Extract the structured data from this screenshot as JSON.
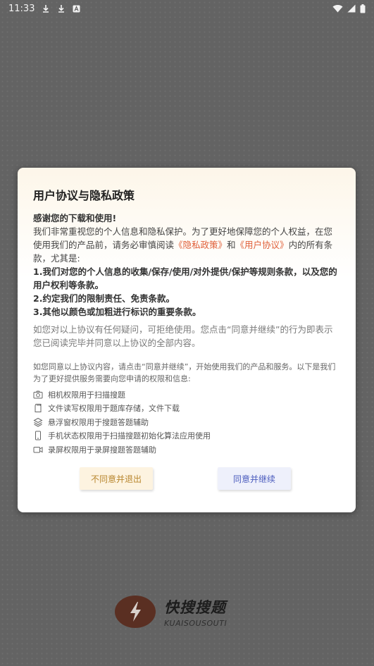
{
  "status_bar": {
    "time": "11:33"
  },
  "dialog": {
    "title": "用户协议与隐私政策",
    "greeting": "感谢您的下载和使用!",
    "intro": {
      "before": "我们非常重视您的个人信息和隐私保护。为了更好地保障您的个人权益，在您使用我们的产品前，请务必审慎阅读",
      "link_privacy": "《隐私政策》",
      "and": "和",
      "link_agreement": "《用户协议》",
      "after": "内的所有条款，尤其是:"
    },
    "clauses": [
      "1.我们对您的个人信息的收集/保存/使用/对外提供/保护等规则条款，以及您的用户权利等条款。",
      "2.约定我们的限制责任、免责条款。",
      "3.其他以颜色或加粗进行标识的重要条款。"
    ],
    "question_text": "如您对以上协议有任何疑问，可拒绝使用。您点击“同意并继续”的行为即表示您已阅读完毕并同意以上协议的全部内容。",
    "consent_text": "如您同意以上协议内容，请点击“同意并继续”，开始使用我们的产品和服务。以下是我们为了更好提供服务需要向您申请的权限和信息:",
    "permissions": [
      {
        "icon": "camera-icon",
        "label": "相机权限用于扫描搜题"
      },
      {
        "icon": "storage-icon",
        "label": "文件读写权限用于题库存储，文件下载"
      },
      {
        "icon": "layers-icon",
        "label": "悬浮窗权限用于搜题答题辅助"
      },
      {
        "icon": "phone-icon",
        "label": "手机状态权限用于扫描搜题初始化算法应用使用"
      },
      {
        "icon": "video-icon",
        "label": "录屏权限用于录屏搜题答题辅助"
      }
    ],
    "decline_label": "不同意并退出",
    "agree_label": "同意并继续"
  },
  "brand": {
    "name": "快搜搜题",
    "subtitle": "KUAISOUSOUTI"
  },
  "colors": {
    "link": "#e0603a",
    "decline_text": "#b8862e",
    "agree_text": "#4a5bbd"
  }
}
